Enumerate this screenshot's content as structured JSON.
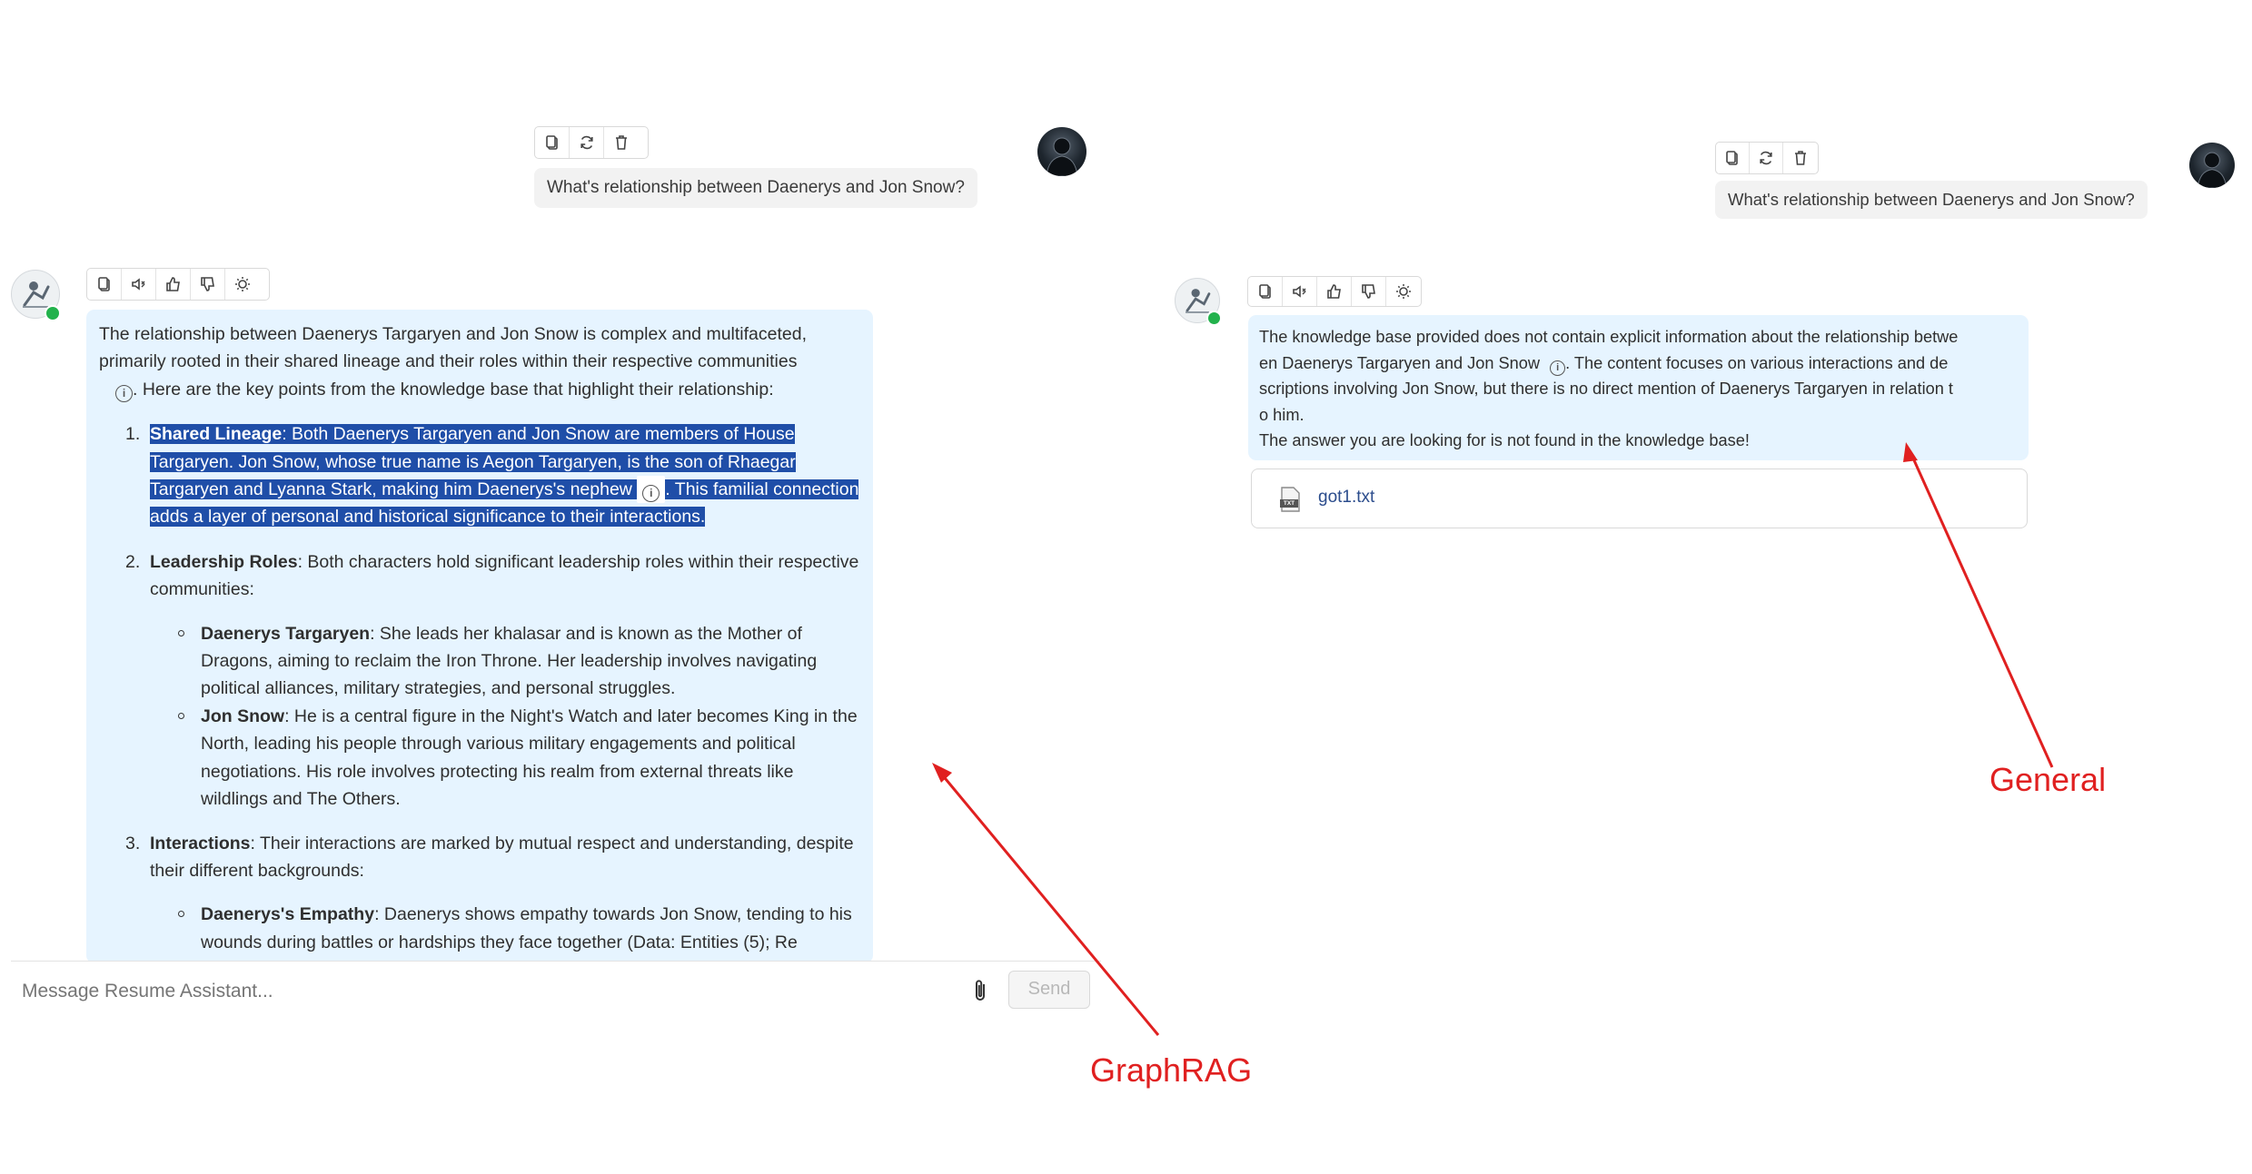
{
  "left": {
    "user_message": "What's relationship between Daenerys and Jon Snow?",
    "intro": "The relationship between Daenerys Targaryen and Jon Snow is complex and multifaceted, primarily rooted in their shared lineage and their roles within their respective communities",
    "intro_after_icon": ". Here are the key points from the knowledge base that highlight their relationship:",
    "points": [
      {
        "num": "1.",
        "title": "Shared Lineage",
        "text": ": Both Daenerys Targaryen and Jon Snow are members of House Targaryen. Jon Snow, whose true name is Aegon Targaryen, is the son of Rhaegar Targaryen and Lyanna Stark, making him Daenerys's nephew",
        "text_after_icon": ". This familial connection adds a layer of personal and historical significance to their interactions."
      },
      {
        "num": "2.",
        "title": "Leadership Roles",
        "text": ": Both characters hold significant leadership roles within their respective communities:",
        "sub": [
          {
            "title": "Daenerys Targaryen",
            "text": ": She leads her khalasar and is known as the Mother of Dragons, aiming to reclaim the Iron Throne. Her leadership involves navigating political alliances, military strategies, and personal struggles."
          },
          {
            "title": "Jon Snow",
            "text": ": He is a central figure in the Night's Watch and later becomes King in the North, leading his people through various military engagements and political negotiations. His role involves protecting his realm from external threats like wildlings and The Others."
          }
        ]
      },
      {
        "num": "3.",
        "title": "Interactions",
        "text": ": Their interactions are marked by mutual respect and understanding, despite their different backgrounds:",
        "sub": [
          {
            "title": "Daenerys's Empathy",
            "text": ": Daenerys shows empathy towards Jon Snow, tending to his wounds during battles or hardships they face together (Data: Entities (5); Re"
          }
        ]
      }
    ],
    "input_placeholder": "Message Resume Assistant...",
    "send_label": "Send"
  },
  "right": {
    "user_message": "What's relationship between Daenerys and Jon Snow?",
    "answer_line1": "The knowledge base provided does not contain explicit information about the relationship betwe",
    "answer_line2a": "en Daenerys Targaryen and Jon Snow",
    "answer_line2b": ". The content focuses on various interactions and de",
    "answer_line3": "scriptions involving Jon Snow, but there is no direct mention of Daenerys Targaryen in relation t",
    "answer_line4": "o him.",
    "answer_line5": "The answer you are looking for is not found in the knowledge base!",
    "file_name": "got1.txt",
    "file_badge": "TXT"
  },
  "annotations": {
    "graphrag": "GraphRAG",
    "general": "General",
    "color": "#e02020"
  },
  "colors": {
    "answer_bg": "#e6f4ff",
    "highlight": "#1f4ea8",
    "online": "#22b24c"
  }
}
